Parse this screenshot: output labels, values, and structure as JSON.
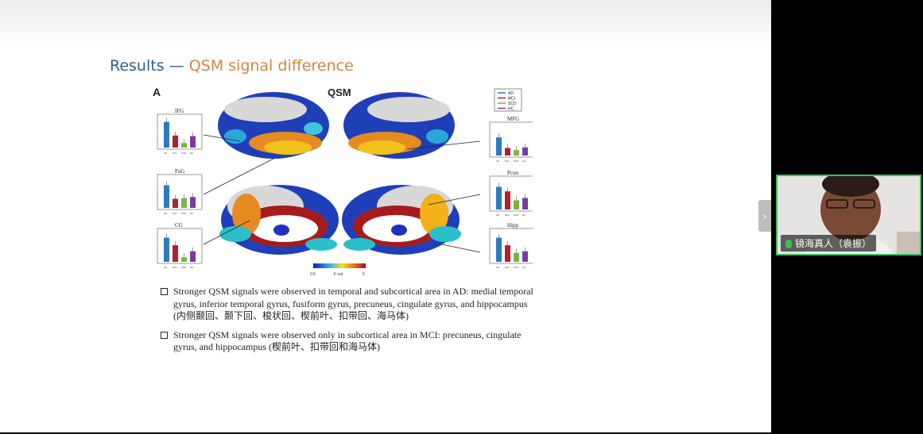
{
  "slide": {
    "title_prefix": "Results — ",
    "title_main": "QSM signal difference",
    "figure": {
      "panel_letter": "A",
      "center_label": "QSM",
      "colorbar": {
        "label": "F-val",
        "min": "0.5",
        "max": "5"
      },
      "legend": [
        "AD",
        "MCI",
        "SCD",
        "HC"
      ],
      "legend_colors": [
        "#2a7bbf",
        "#b02030",
        "#7cb342",
        "#7a3aa0"
      ],
      "chart_labels": {
        "ifg": "IFG",
        "fug": "FuG",
        "cg": "CG",
        "mfg": "MFG",
        "pcun": "Pcun",
        "hipp": "Hipp"
      },
      "x_ticks": [
        "AD",
        "MCI",
        "SCD",
        "HC"
      ]
    },
    "bullets": [
      "Stronger QSM signals were observed in temporal and subcortical area in AD: medial temporal gyrus, inferior temporal gyrus, fusiform gyrus, precuneus, cingulate gyrus, and hippocampus (内侧颞回、颞下回、梭状回、楔前叶、扣带回、海马体)",
      "Stronger QSM signals were observed only in subcortical area in MCI: precuneus, cingulate gyrus, and hippocampus (楔前叶、扣带回和海马体)"
    ]
  },
  "sidebar": {
    "collapse_icon": "chevron-right-icon",
    "participant_name": "镜海真人（袁振）",
    "active_speaker_color": "#3cbf5a"
  }
}
